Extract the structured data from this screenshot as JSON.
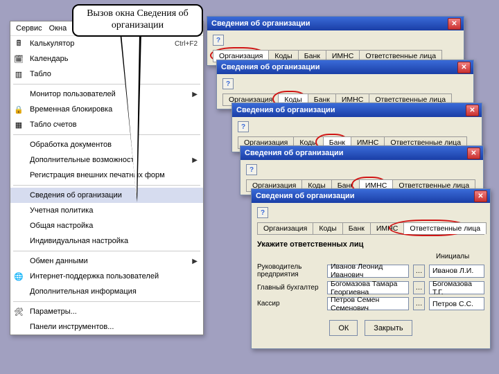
{
  "callout": {
    "line1": "Вызов окна Сведения об",
    "line2": "организации"
  },
  "menubar": {
    "service": "Сервис",
    "windows": "Окна"
  },
  "menu": {
    "calc": {
      "label": "Калькулятор",
      "shortcut": "Ctrl+F2"
    },
    "calendar": {
      "label": "Календарь"
    },
    "tablo": {
      "label": "Табло"
    },
    "monitor": {
      "label": "Монитор пользователей"
    },
    "lock": {
      "label": "Временная блокировка"
    },
    "accounts": {
      "label": "Табло счетов"
    },
    "docproc": {
      "label": "Обработка документов"
    },
    "extra": {
      "label": "Дополнительные возможности"
    },
    "extprint": {
      "label": "Регистрация внешних печатных форм"
    },
    "orginfo": {
      "label": "Сведения об организации"
    },
    "acctpolicy": {
      "label": "Учетная политика"
    },
    "general": {
      "label": "Общая настройка"
    },
    "indiv": {
      "label": "Индивидуальная настройка"
    },
    "exchange": {
      "label": "Обмен данными"
    },
    "inetsupport": {
      "label": "Интернет-поддержка пользователей"
    },
    "addinfo": {
      "label": "Дополнительная информация"
    },
    "params": {
      "label": "Параметры..."
    },
    "panels": {
      "label": "Панели инструментов..."
    }
  },
  "window_title": "Сведения об организации",
  "tabs": {
    "org": "Организация",
    "codes": "Коды",
    "bank": "Банк",
    "imns": "ИМНС",
    "resp": "Ответственные лица"
  },
  "resp_panel": {
    "heading": "Укажите ответственных лиц",
    "col1": "Инициалы",
    "rows": {
      "r1_lbl": "Руководитель предприятия",
      "r1_val": "Иванов Леонид Иванович",
      "r1_init": "Иванов Л.И.",
      "r2_lbl": "Главный бухгалтер",
      "r2_val": "Богомазова Тамара Георгиевна",
      "r2_init": "Богомазова Т.Г.",
      "r3_lbl": "Кассир",
      "r3_val": "Петров Семен Семенович",
      "r3_init": "Петров С.С."
    }
  },
  "buttons": {
    "ok": "ОК",
    "close": "Закрыть"
  }
}
